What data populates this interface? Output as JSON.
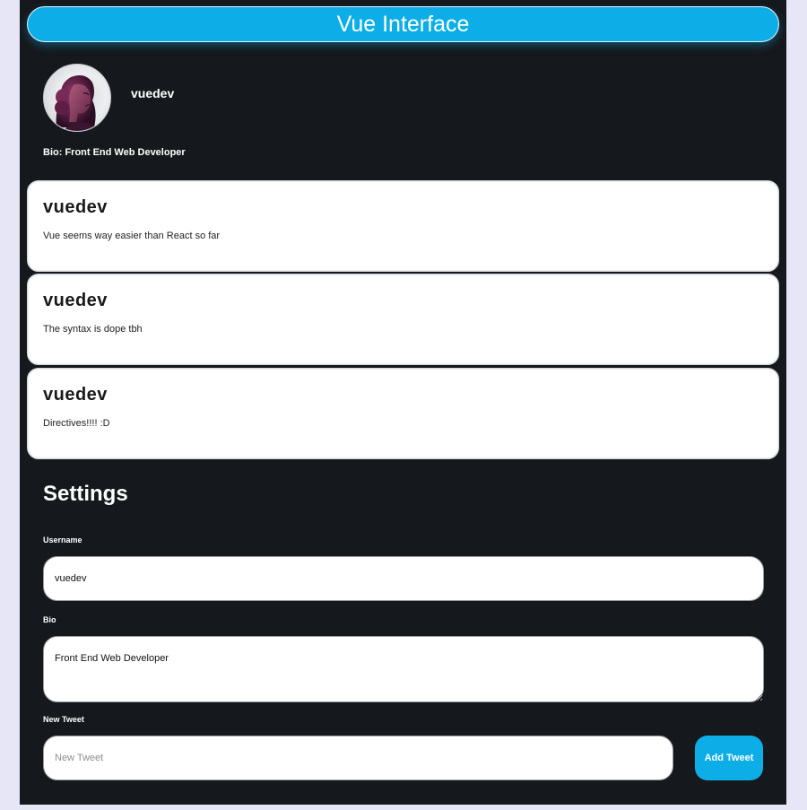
{
  "header": {
    "title": "Vue Interface"
  },
  "profile": {
    "username": "vuedev",
    "bio_label": "Bio: Front End Web Developer"
  },
  "tweets": [
    {
      "author": "vuedev",
      "text": "Vue seems way easier than React so far"
    },
    {
      "author": "vuedev",
      "text": "The syntax is dope tbh"
    },
    {
      "author": "vuedev",
      "text": "Directives!!!! :D"
    }
  ],
  "settings": {
    "heading": "Settings",
    "username_label": "Username",
    "username_value": "vuedev",
    "bio_label": "Bio",
    "bio_value": "Front End Web Developer",
    "new_tweet_label": "New Tweet",
    "new_tweet_placeholder": "New Tweet",
    "add_tweet_label": "Add Tweet"
  },
  "colors": {
    "accent": "#0daee8",
    "panel": "#15181c",
    "page_background": "#e6e6f7"
  }
}
